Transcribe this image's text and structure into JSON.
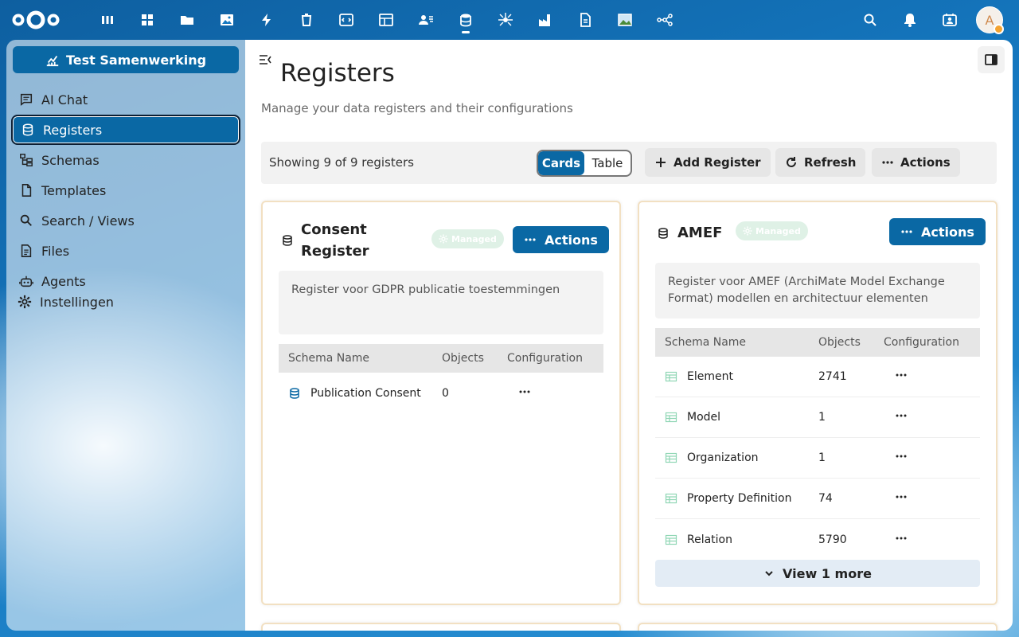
{
  "topbar": {
    "apps": [
      {
        "icon": "dashboard-icon",
        "name": "app-dashboard"
      },
      {
        "icon": "apps-icon",
        "name": "app-apps"
      },
      {
        "icon": "folder-icon",
        "name": "app-files"
      },
      {
        "icon": "image-icon",
        "name": "app-photos"
      },
      {
        "icon": "lightning-icon",
        "name": "app-activity"
      },
      {
        "icon": "trash-icon",
        "name": "app-deleted"
      },
      {
        "icon": "code-icon",
        "name": "app-code"
      },
      {
        "icon": "table-icon",
        "name": "app-tables"
      },
      {
        "icon": "contacts-icon",
        "name": "app-contacts"
      },
      {
        "icon": "database-icon",
        "name": "app-openregister"
      },
      {
        "icon": "spider-icon",
        "name": "app-crawler"
      },
      {
        "icon": "factory-icon",
        "name": "app-organizations"
      },
      {
        "icon": "document-icon",
        "name": "app-docs"
      },
      {
        "icon": "picture-icon",
        "name": "app-gallery"
      },
      {
        "icon": "flow-icon",
        "name": "app-flow"
      }
    ],
    "avatar_letter": "A",
    "accent": "#0a68a4"
  },
  "nav": {
    "org_button": "Test Samenwerking",
    "items": [
      {
        "label": "AI Chat",
        "icon": "chat-icon"
      },
      {
        "label": "Registers",
        "icon": "database-icon"
      },
      {
        "label": "Schemas",
        "icon": "schema-icon"
      },
      {
        "label": "Templates",
        "icon": "file-icon"
      },
      {
        "label": "Search / Views",
        "icon": "search-icon"
      },
      {
        "label": "Files",
        "icon": "files-icon"
      },
      {
        "label": "Agents",
        "icon": "robot-icon"
      }
    ],
    "settings": "Instellingen"
  },
  "page": {
    "title": "Registers",
    "subtitle": "Manage your data registers and their configurations"
  },
  "toolbar": {
    "count": "Showing 9 of 9 registers",
    "view_cards": "Cards",
    "view_table": "Table",
    "add": "Add Register",
    "refresh": "Refresh",
    "actions": "Actions"
  },
  "cards": [
    {
      "title_line1": "Consent",
      "title_line2": "Register",
      "badge": "Managed",
      "actions": "Actions",
      "description": "Register voor GDPR publicatie toestemmingen",
      "headers": [
        "Schema Name",
        "Objects",
        "Configuration"
      ],
      "rows": [
        {
          "name": "Publication Consent",
          "objects": "0"
        }
      ]
    },
    {
      "title": "AMEF",
      "badge": "Managed",
      "actions": "Actions",
      "description": "Register voor AMEF (ArchiMate Model Exchange Format) modellen en architectuur elementen",
      "headers": [
        "Schema Name",
        "Objects",
        "Configuration"
      ],
      "rows": [
        {
          "name": "Element",
          "objects": "2741"
        },
        {
          "name": "Model",
          "objects": "1"
        },
        {
          "name": "Organization",
          "objects": "1"
        },
        {
          "name": "Property Definition",
          "objects": "74"
        },
        {
          "name": "Relation",
          "objects": "5790"
        }
      ],
      "more": "View 1 more"
    }
  ]
}
